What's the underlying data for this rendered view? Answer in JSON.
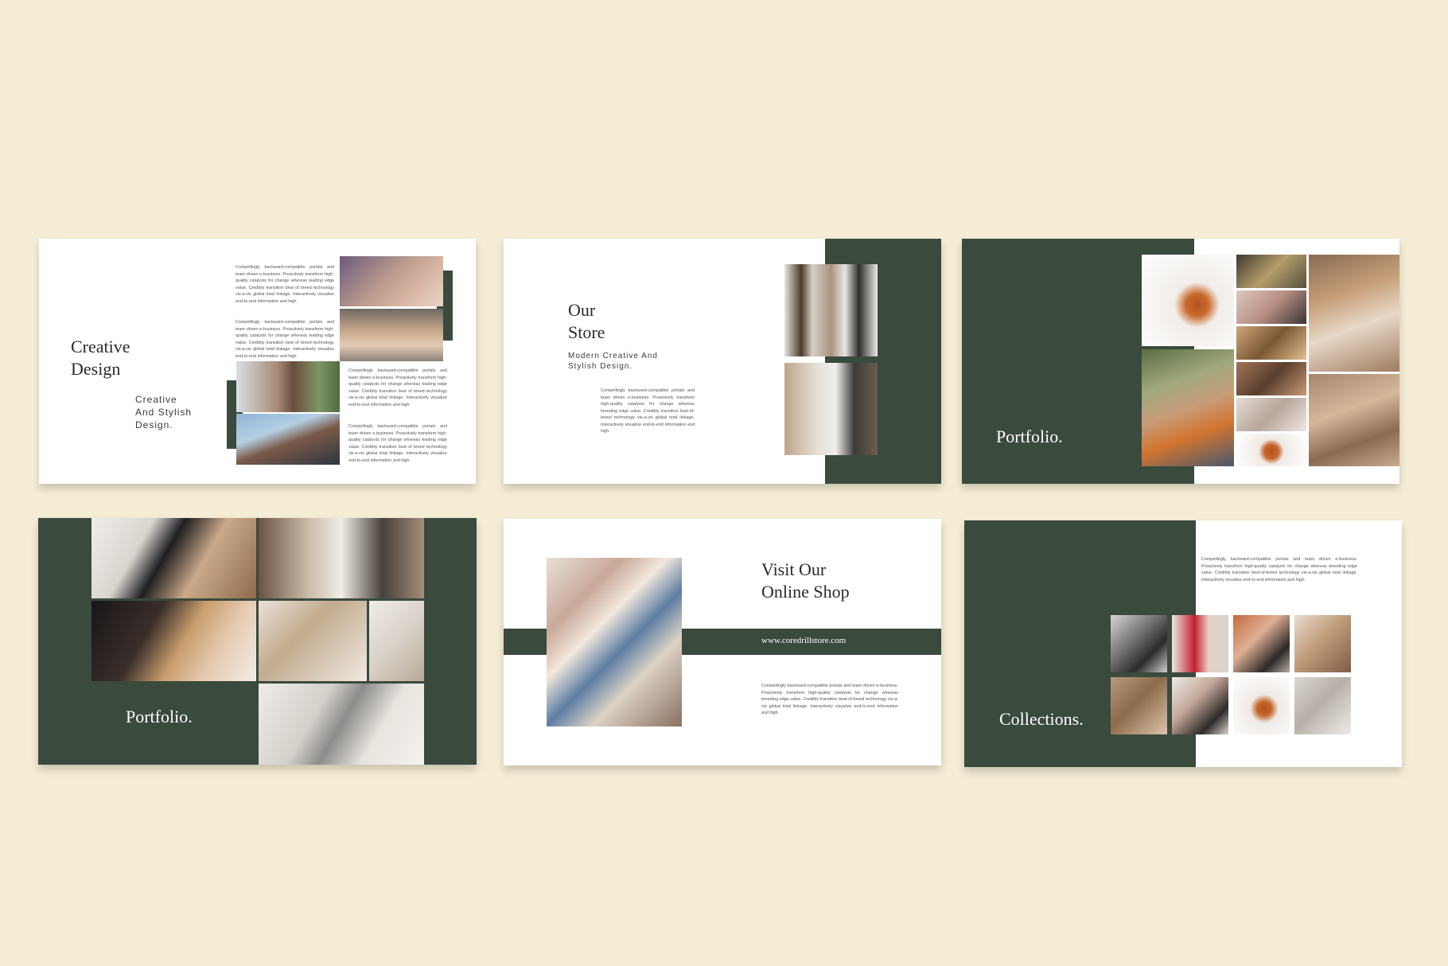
{
  "colors": {
    "background": "#f5edd5",
    "accent": "#3a4a3d",
    "slide": "#ffffff"
  },
  "slide1": {
    "title": "Creative\nDesign",
    "subtitle": "Creative\nAnd Stylish\nDesign.",
    "para1": "Compellingly backward-compatible portals and team driven e-business. Proactively transform high-quality catalysts for change whereas leading edge value. Credibly transition best of breed technology vis-a-vis global total linkage. Interactively visualize end-to-end information and high.",
    "para2": "Compellingly backward-compatible portals and team driven e-business. Proactively transform high-quality catalysts for change whereas leading edge value. Credibly transition best of breed technology vis-a-vis global total linkage. Interactively visualize end-to-end information and high.",
    "para3": "Compellingly backward-compatible portals and team driven e-business. Proactively transform high-quality catalysts for change whereas leading edge value. Credibly transition best of breed technology vis-a-vis global total linkage. Interactively visualize end-to-end information and high.",
    "para4": "Compellingly backward-compatible portals and team driven e-business. Proactively transform high-quality catalysts for change whereas leading edge value. Credibly transition best of breed technology vis-a-vis global total linkage. Interactively visualize end-to-end information and high."
  },
  "slide2": {
    "title": "Our\nStore",
    "subtitle": "Modern Creative And\nStylish Design.",
    "para": "Compellingly backward-compatible portals and team driven e-business. Proactively transform high-quality catalysts for change whereas breeding edge value. Credibly transition best-of-breed technology vis-a-vis global total linkage. Interactively visualize end-to-end information and high."
  },
  "slide3": {
    "title": "Portfolio."
  },
  "slide4": {
    "title": "Portfolio."
  },
  "slide5": {
    "title": "Visit Our\nOnline Shop",
    "url": "www.coredrillstore.com",
    "para": "Compellingly backward-compatible portals and team driven e-business. Proactively transform high-quality catalysts for change whereas breeding edge value. Credibly transition best-of-breed technology vis-a-vis global total linkage. Interactively visualize end-to-end information and high."
  },
  "slide6": {
    "title": "Collections.",
    "para": "Compellingly backward-compatible portals and team driven e-business. Proactively transform high-quality catalysts for change whereas breeding edge value. Credibly transition best-of-breed technology vis-a-vis global total linkage. Interactively visualize end-to-end information and high."
  }
}
